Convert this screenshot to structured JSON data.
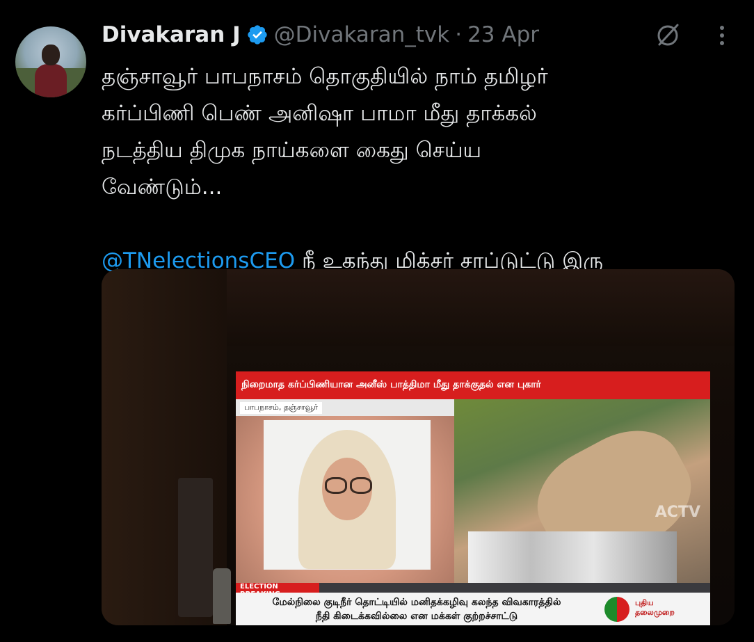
{
  "tweet": {
    "author_name": "Divakaran J",
    "handle": "@Divakaran_tvk",
    "separator": "·",
    "date": "23 Apr",
    "text_lines": [
      "தஞ்சாவூர் பாபநாசம் தொகுதியில் நாம் தமிழர்",
      "கர்ப்பிணி பெண் அனிஷா பாமா மீது தாக்கல்",
      "நடத்திய திமுக நாய்களை கைது செய்ய",
      "வேண்டும்..."
    ],
    "mention": "@TNelectionsCEO",
    "mention_suffix": " நீ உகந்து மிக்சர் சாப்டுட்டு இரு"
  },
  "media": {
    "ticker_top": "நிறைமாத கர்ப்பிணியான அனீஸ் பாத்திமா மீது தாக்குதல் என புகார்",
    "location_label": "பாபநாசம், தஞ்சாவூர்",
    "breaking_label": "ELECTION BREAKING",
    "ticker_bottom_line1": "மேல்நிலை குடிநீர் தொட்டியில் மனிதக்கழிவு கலந்த விவகாரத்தில்",
    "ticker_bottom_line2": "நீதி கிடைக்கவில்லை என மக்கள் குற்றச்சாட்டு",
    "watermark": "ACTV",
    "channel_name_line1": "புதிய",
    "channel_name_line2": "தலைமுறை"
  },
  "icons": {
    "verified": "verified-badge-icon",
    "grok": "grok-icon",
    "more": "more-options-icon"
  },
  "colors": {
    "background": "#000000",
    "text": "#e7e9ea",
    "secondary": "#71767b",
    "mention": "#1d9bf0",
    "verified": "#1d9bf0"
  }
}
